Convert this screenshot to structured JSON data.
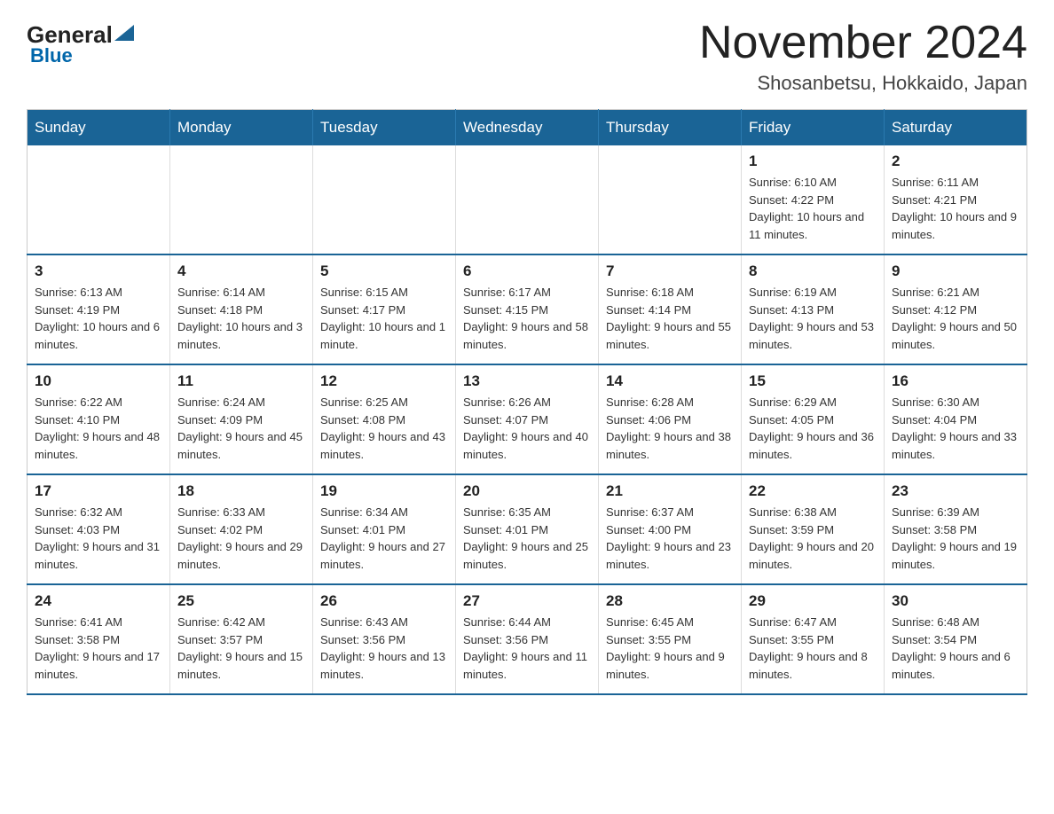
{
  "header": {
    "logo_general": "General",
    "logo_blue": "Blue",
    "month_title": "November 2024",
    "location": "Shosanbetsu, Hokkaido, Japan"
  },
  "weekdays": [
    "Sunday",
    "Monday",
    "Tuesday",
    "Wednesday",
    "Thursday",
    "Friday",
    "Saturday"
  ],
  "weeks": [
    [
      {
        "day": "",
        "info": ""
      },
      {
        "day": "",
        "info": ""
      },
      {
        "day": "",
        "info": ""
      },
      {
        "day": "",
        "info": ""
      },
      {
        "day": "",
        "info": ""
      },
      {
        "day": "1",
        "info": "Sunrise: 6:10 AM\nSunset: 4:22 PM\nDaylight: 10 hours and 11 minutes."
      },
      {
        "day": "2",
        "info": "Sunrise: 6:11 AM\nSunset: 4:21 PM\nDaylight: 10 hours and 9 minutes."
      }
    ],
    [
      {
        "day": "3",
        "info": "Sunrise: 6:13 AM\nSunset: 4:19 PM\nDaylight: 10 hours and 6 minutes."
      },
      {
        "day": "4",
        "info": "Sunrise: 6:14 AM\nSunset: 4:18 PM\nDaylight: 10 hours and 3 minutes."
      },
      {
        "day": "5",
        "info": "Sunrise: 6:15 AM\nSunset: 4:17 PM\nDaylight: 10 hours and 1 minute."
      },
      {
        "day": "6",
        "info": "Sunrise: 6:17 AM\nSunset: 4:15 PM\nDaylight: 9 hours and 58 minutes."
      },
      {
        "day": "7",
        "info": "Sunrise: 6:18 AM\nSunset: 4:14 PM\nDaylight: 9 hours and 55 minutes."
      },
      {
        "day": "8",
        "info": "Sunrise: 6:19 AM\nSunset: 4:13 PM\nDaylight: 9 hours and 53 minutes."
      },
      {
        "day": "9",
        "info": "Sunrise: 6:21 AM\nSunset: 4:12 PM\nDaylight: 9 hours and 50 minutes."
      }
    ],
    [
      {
        "day": "10",
        "info": "Sunrise: 6:22 AM\nSunset: 4:10 PM\nDaylight: 9 hours and 48 minutes."
      },
      {
        "day": "11",
        "info": "Sunrise: 6:24 AM\nSunset: 4:09 PM\nDaylight: 9 hours and 45 minutes."
      },
      {
        "day": "12",
        "info": "Sunrise: 6:25 AM\nSunset: 4:08 PM\nDaylight: 9 hours and 43 minutes."
      },
      {
        "day": "13",
        "info": "Sunrise: 6:26 AM\nSunset: 4:07 PM\nDaylight: 9 hours and 40 minutes."
      },
      {
        "day": "14",
        "info": "Sunrise: 6:28 AM\nSunset: 4:06 PM\nDaylight: 9 hours and 38 minutes."
      },
      {
        "day": "15",
        "info": "Sunrise: 6:29 AM\nSunset: 4:05 PM\nDaylight: 9 hours and 36 minutes."
      },
      {
        "day": "16",
        "info": "Sunrise: 6:30 AM\nSunset: 4:04 PM\nDaylight: 9 hours and 33 minutes."
      }
    ],
    [
      {
        "day": "17",
        "info": "Sunrise: 6:32 AM\nSunset: 4:03 PM\nDaylight: 9 hours and 31 minutes."
      },
      {
        "day": "18",
        "info": "Sunrise: 6:33 AM\nSunset: 4:02 PM\nDaylight: 9 hours and 29 minutes."
      },
      {
        "day": "19",
        "info": "Sunrise: 6:34 AM\nSunset: 4:01 PM\nDaylight: 9 hours and 27 minutes."
      },
      {
        "day": "20",
        "info": "Sunrise: 6:35 AM\nSunset: 4:01 PM\nDaylight: 9 hours and 25 minutes."
      },
      {
        "day": "21",
        "info": "Sunrise: 6:37 AM\nSunset: 4:00 PM\nDaylight: 9 hours and 23 minutes."
      },
      {
        "day": "22",
        "info": "Sunrise: 6:38 AM\nSunset: 3:59 PM\nDaylight: 9 hours and 20 minutes."
      },
      {
        "day": "23",
        "info": "Sunrise: 6:39 AM\nSunset: 3:58 PM\nDaylight: 9 hours and 19 minutes."
      }
    ],
    [
      {
        "day": "24",
        "info": "Sunrise: 6:41 AM\nSunset: 3:58 PM\nDaylight: 9 hours and 17 minutes."
      },
      {
        "day": "25",
        "info": "Sunrise: 6:42 AM\nSunset: 3:57 PM\nDaylight: 9 hours and 15 minutes."
      },
      {
        "day": "26",
        "info": "Sunrise: 6:43 AM\nSunset: 3:56 PM\nDaylight: 9 hours and 13 minutes."
      },
      {
        "day": "27",
        "info": "Sunrise: 6:44 AM\nSunset: 3:56 PM\nDaylight: 9 hours and 11 minutes."
      },
      {
        "day": "28",
        "info": "Sunrise: 6:45 AM\nSunset: 3:55 PM\nDaylight: 9 hours and 9 minutes."
      },
      {
        "day": "29",
        "info": "Sunrise: 6:47 AM\nSunset: 3:55 PM\nDaylight: 9 hours and 8 minutes."
      },
      {
        "day": "30",
        "info": "Sunrise: 6:48 AM\nSunset: 3:54 PM\nDaylight: 9 hours and 6 minutes."
      }
    ]
  ]
}
